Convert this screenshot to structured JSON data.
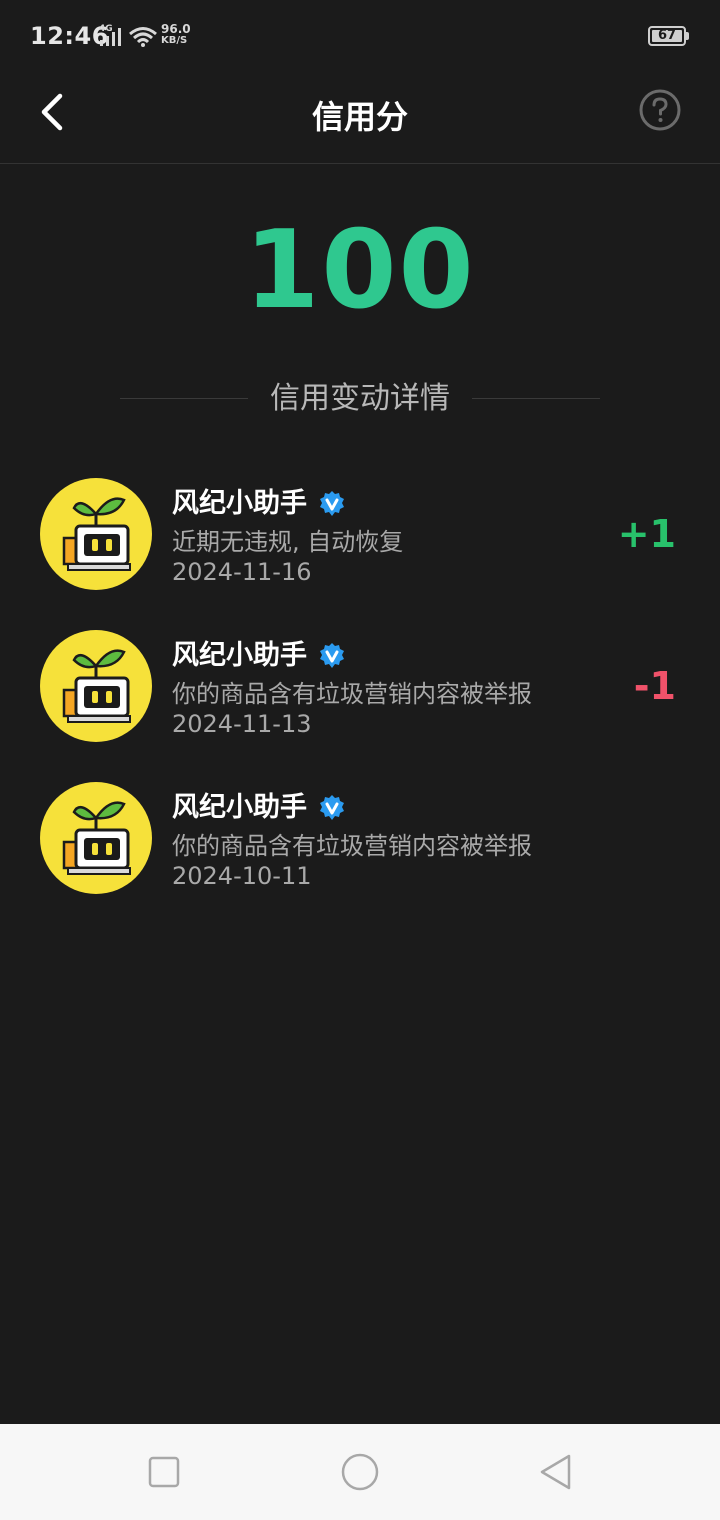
{
  "status_bar": {
    "time": "12:46",
    "network": "4G",
    "speed_value": "96.0",
    "speed_unit": "KB/S",
    "battery": "67"
  },
  "header": {
    "title": "信用分",
    "back_icon": "chevron-left-icon",
    "help_icon": "question-circle-icon"
  },
  "score": {
    "value": "100",
    "color": "#2fc88f"
  },
  "section": {
    "label": "信用变动详情"
  },
  "records": [
    {
      "name": "风纪小助手",
      "desc": "近期无违规, 自动恢复",
      "date": "2024-11-16",
      "delta": "+1",
      "delta_color": "#28c16b"
    },
    {
      "name": "风纪小助手",
      "desc": "你的商品含有垃圾营销内容被举报",
      "date": "2024-11-13",
      "delta": "-1",
      "delta_color": "#f0526a"
    },
    {
      "name": "风纪小助手",
      "desc": "你的商品含有垃圾营销内容被举报",
      "date": "2024-10-11",
      "delta": ""
    }
  ],
  "nav_bar": {
    "icons": [
      "recents-square-icon",
      "home-circle-icon",
      "back-triangle-icon"
    ]
  }
}
